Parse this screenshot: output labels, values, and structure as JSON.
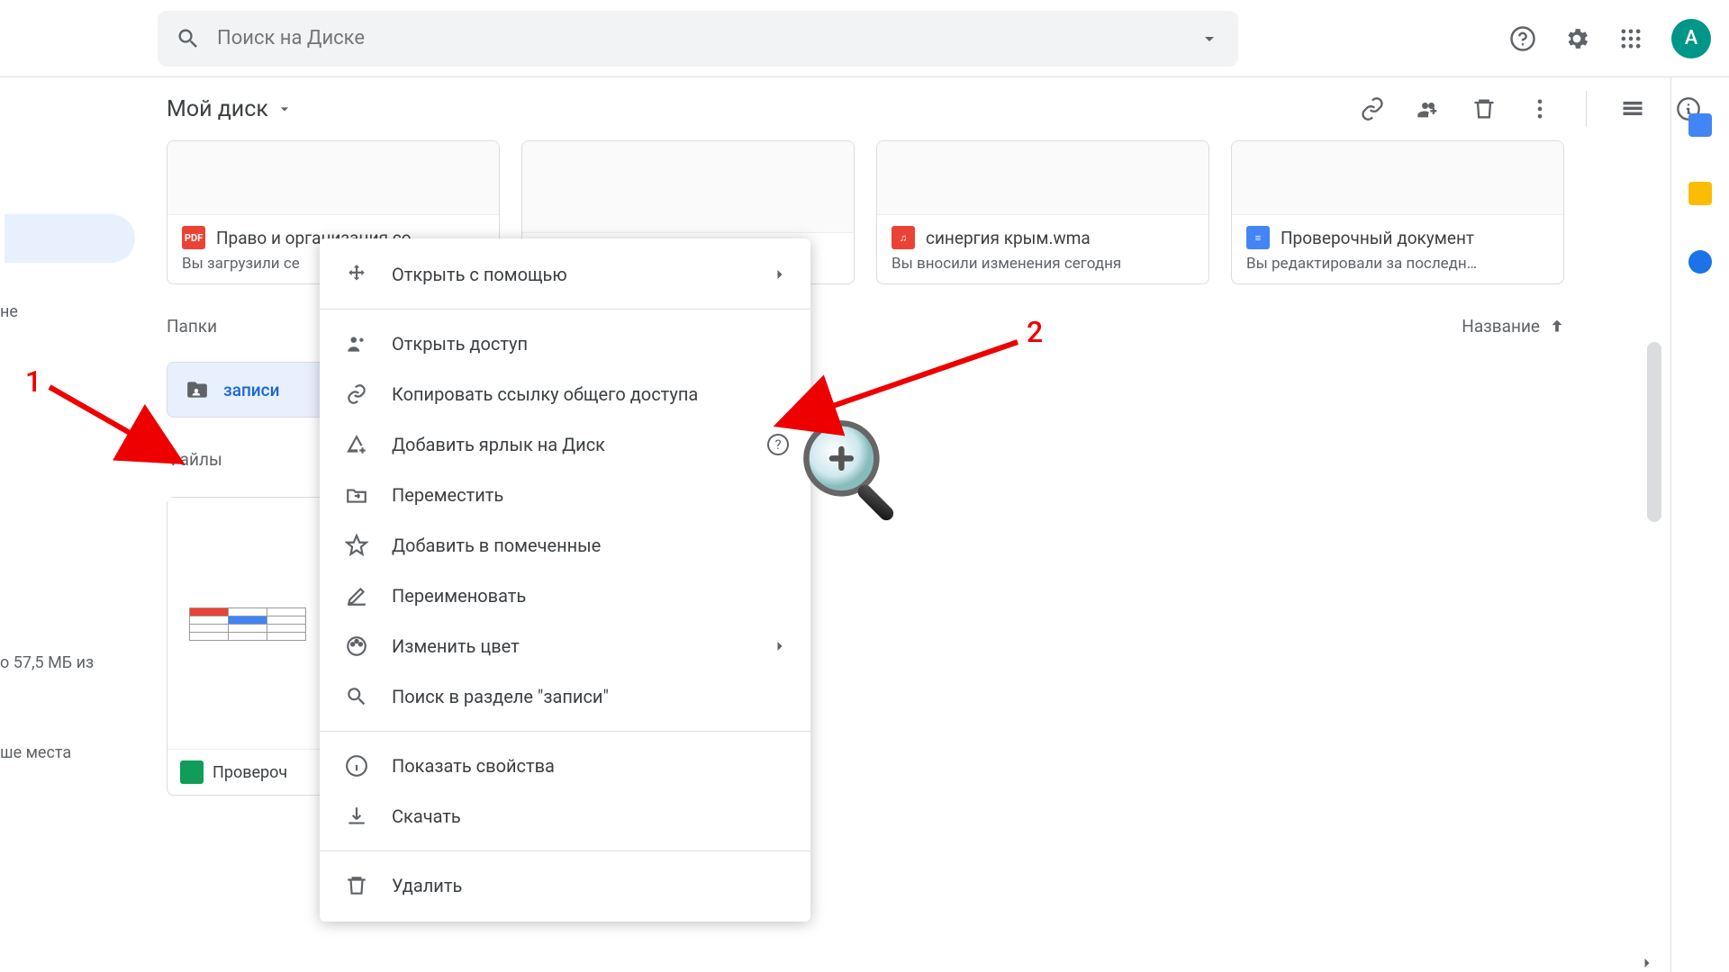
{
  "search": {
    "placeholder": "Поиск на Диске"
  },
  "avatar_letter": "А",
  "breadcrumb": "Мой диск",
  "sidebar": {
    "truncated1": "не",
    "storage_text": "о 57,5 МБ из",
    "storage_link": "ше места"
  },
  "cards": [
    {
      "icon": "pdf",
      "icon_text": "PDF",
      "title": "Право и организация со",
      "sub": "Вы загрузили се"
    },
    {
      "icon": "sheet",
      "icon_text": "",
      "title": "",
      "sub": ""
    },
    {
      "icon": "audio",
      "icon_text": "♫",
      "title": "синергия крым.wma",
      "sub": "Вы вносили изменения сегодня"
    },
    {
      "icon": "doc",
      "icon_text": "≡",
      "title": "Проверочный документ",
      "sub": "Вы редактировали за последн…"
    }
  ],
  "sections": {
    "folders": "Папки",
    "files": "Файлы"
  },
  "sort": {
    "label": "Название"
  },
  "folder": {
    "name": "записи"
  },
  "file_below": {
    "name": "Провероч"
  },
  "context_menu": [
    {
      "icon": "open-with",
      "label": "Открыть с помощью",
      "has_chevron": true
    },
    {
      "sep": true
    },
    {
      "icon": "share",
      "label": "Открыть доступ"
    },
    {
      "icon": "link",
      "label": "Копировать ссылку общего доступа"
    },
    {
      "icon": "drive-add",
      "label": "Добавить ярлык на Диск",
      "has_help": true
    },
    {
      "icon": "move",
      "label": "Переместить"
    },
    {
      "icon": "star",
      "label": "Добавить в помеченные"
    },
    {
      "icon": "rename",
      "label": "Переименовать"
    },
    {
      "icon": "palette",
      "label": "Изменить цвет",
      "has_chevron": true
    },
    {
      "icon": "search",
      "label": "Поиск в разделе \"записи\""
    },
    {
      "sep": true
    },
    {
      "icon": "info",
      "label": "Показать свойства"
    },
    {
      "icon": "download",
      "label": "Скачать"
    },
    {
      "sep": true
    },
    {
      "icon": "delete",
      "label": "Удалить"
    }
  ],
  "annotations": {
    "one": "1",
    "two": "2"
  }
}
